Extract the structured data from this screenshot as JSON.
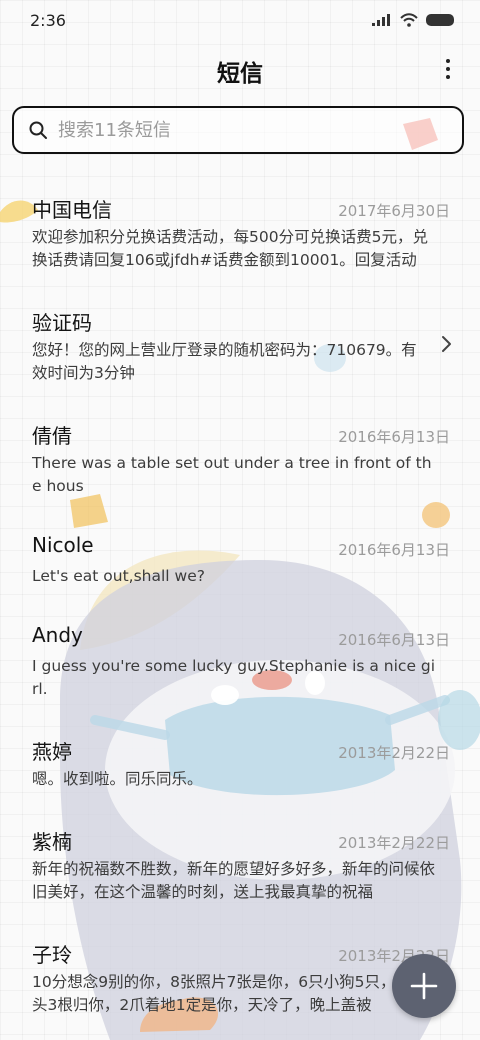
{
  "status_bar": {
    "time": "2:36",
    "icons": [
      "signal-icon",
      "wifi-icon",
      "battery-icon"
    ]
  },
  "header": {
    "title": "短信",
    "menu_icon": "more-vertical-icon"
  },
  "search": {
    "placeholder": "搜索11条短信",
    "value": ""
  },
  "threads": [
    {
      "name": "中国电信",
      "date": "2017年6月30日",
      "preview": "欢迎参加积分兑换话费活动，每500分可兑换话费5元，兑换话费请回复106或jfdh#话费金额到10001。回复活动"
    },
    {
      "name": "验证码",
      "date": "",
      "preview": "您好！您的网上营业厅登录的随机密码为：710679。有效时间为3分钟",
      "chevron": "chevron-right-icon"
    },
    {
      "name": "倩倩",
      "date": "2016年6月13日",
      "preview": "There was a table set out under a tree in front of the hous"
    },
    {
      "name": "Nicole",
      "date": "2016年6月13日",
      "preview": "Let's eat out,shall we?"
    },
    {
      "name": "Andy",
      "date": "2016年6月13日",
      "preview": "I guess you're some lucky guy.Stephanie is a nice girl."
    },
    {
      "name": "燕婷",
      "date": "2013年2月22日",
      "preview": "嗯。收到啦。同乐同乐。"
    },
    {
      "name": "紫楠",
      "date": "2013年2月22日",
      "preview": "新年的祝福数不胜数，新年的愿望好多好多，新年的问候依旧美好，在这个温馨的时刻，送上我最真挚的祝福"
    },
    {
      "name": "子玲",
      "date": "2013年2月22日",
      "preview": "10分想念9别的你，8张照片7张是你，6只小狗5只，4根骨头3根归你，2爪着地1定是你，天冷了，晚上盖被"
    }
  ],
  "fab": {
    "icon": "plus-icon"
  },
  "colors": {
    "fab": "#5d6271",
    "date": "#9b9b9b",
    "search_border": "#111111"
  }
}
